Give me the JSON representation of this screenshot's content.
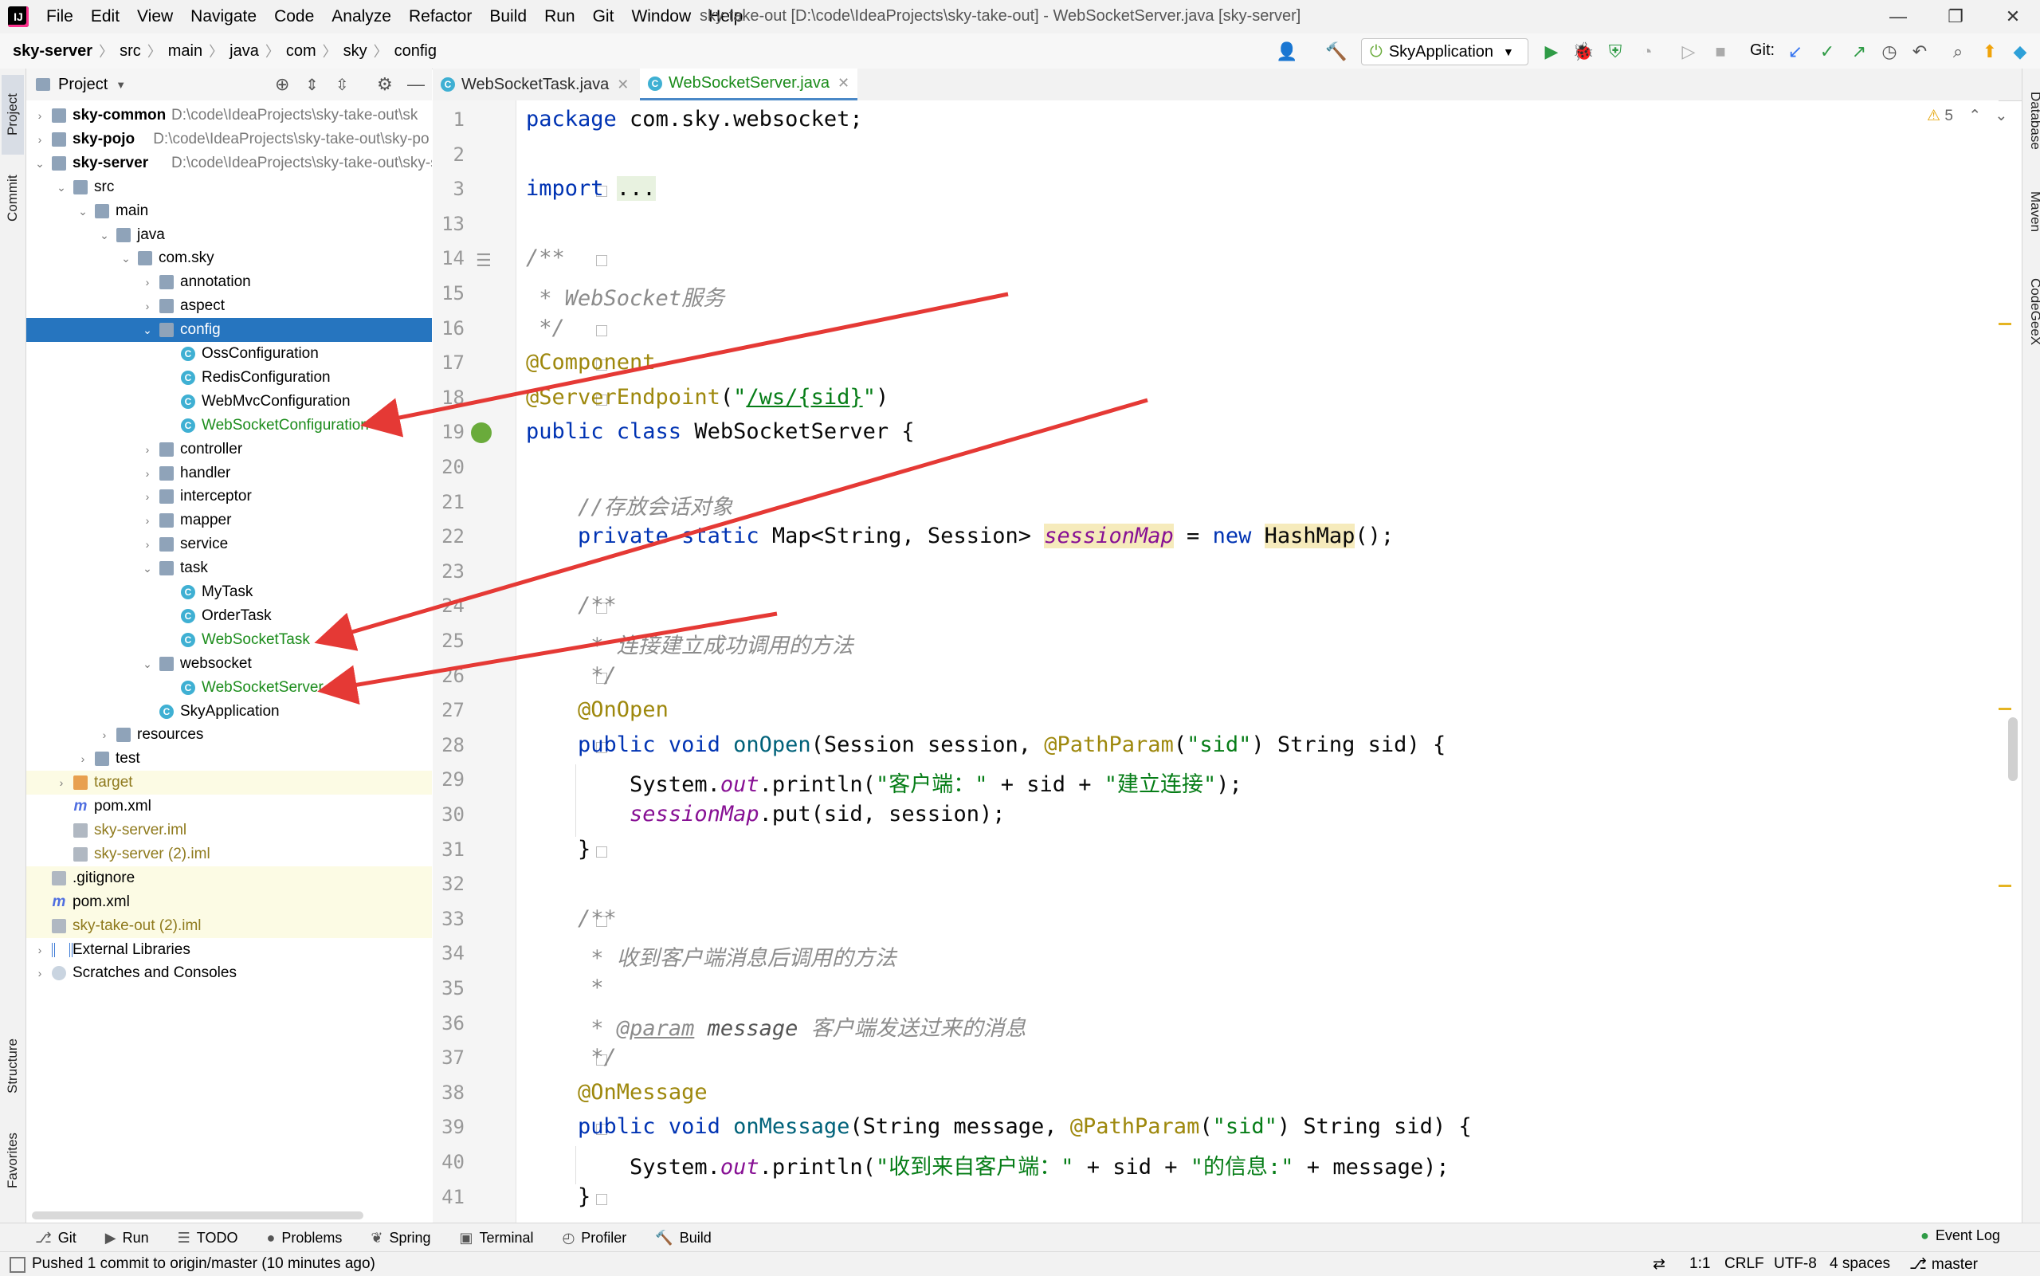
{
  "menu": [
    "File",
    "Edit",
    "View",
    "Navigate",
    "Code",
    "Analyze",
    "Refactor",
    "Build",
    "Run",
    "Git",
    "Window",
    "Help"
  ],
  "window_title": "sky-take-out [D:\\code\\IdeaProjects\\sky-take-out] - WebSocketServer.java [sky-server]",
  "breadcrumb": [
    "sky-server",
    "src",
    "main",
    "java",
    "com",
    "sky",
    "config"
  ],
  "run_config": "SkyApplication",
  "git_label": "Git:",
  "project_panel": {
    "title": "Project"
  },
  "tree": [
    {
      "depth": 0,
      "arrow": "›",
      "icon": "module",
      "label": "sky-common",
      "bold": true,
      "path": "D:\\code\\IdeaProjects\\sky-take-out\\sk"
    },
    {
      "depth": 0,
      "arrow": "›",
      "icon": "module",
      "label": "sky-pojo",
      "bold": true,
      "path": "D:\\code\\IdeaProjects\\sky-take-out\\sky-po"
    },
    {
      "depth": 0,
      "arrow": "⌄",
      "icon": "module",
      "label": "sky-server",
      "bold": true,
      "path": "D:\\code\\IdeaProjects\\sky-take-out\\sky-s"
    },
    {
      "depth": 1,
      "arrow": "⌄",
      "icon": "folder",
      "label": "src"
    },
    {
      "depth": 2,
      "arrow": "⌄",
      "icon": "folder",
      "label": "main"
    },
    {
      "depth": 3,
      "arrow": "⌄",
      "icon": "folder",
      "label": "java"
    },
    {
      "depth": 4,
      "arrow": "⌄",
      "icon": "folder",
      "label": "com.sky"
    },
    {
      "depth": 5,
      "arrow": "›",
      "icon": "folder",
      "label": "annotation"
    },
    {
      "depth": 5,
      "arrow": "›",
      "icon": "folder",
      "label": "aspect"
    },
    {
      "depth": 5,
      "arrow": "⌄",
      "icon": "folder",
      "label": "config",
      "selected": true
    },
    {
      "depth": 6,
      "arrow": "",
      "icon": "class",
      "label": "OssConfiguration"
    },
    {
      "depth": 6,
      "arrow": "",
      "icon": "class",
      "label": "RedisConfiguration"
    },
    {
      "depth": 6,
      "arrow": "",
      "icon": "class",
      "label": "WebMvcConfiguration"
    },
    {
      "depth": 6,
      "arrow": "",
      "icon": "class",
      "label": "WebSocketConfiguration",
      "color": "green"
    },
    {
      "depth": 5,
      "arrow": "›",
      "icon": "folder",
      "label": "controller"
    },
    {
      "depth": 5,
      "arrow": "›",
      "icon": "folder",
      "label": "handler"
    },
    {
      "depth": 5,
      "arrow": "›",
      "icon": "folder",
      "label": "interceptor"
    },
    {
      "depth": 5,
      "arrow": "›",
      "icon": "folder",
      "label": "mapper"
    },
    {
      "depth": 5,
      "arrow": "›",
      "icon": "folder",
      "label": "service"
    },
    {
      "depth": 5,
      "arrow": "⌄",
      "icon": "folder",
      "label": "task"
    },
    {
      "depth": 6,
      "arrow": "",
      "icon": "class",
      "label": "MyTask"
    },
    {
      "depth": 6,
      "arrow": "",
      "icon": "class",
      "label": "OrderTask"
    },
    {
      "depth": 6,
      "arrow": "",
      "icon": "class",
      "label": "WebSocketTask",
      "color": "green"
    },
    {
      "depth": 5,
      "arrow": "⌄",
      "icon": "folder",
      "label": "websocket"
    },
    {
      "depth": 6,
      "arrow": "",
      "icon": "class",
      "label": "WebSocketServer",
      "color": "green"
    },
    {
      "depth": 5,
      "arrow": "",
      "icon": "class",
      "label": "SkyApplication"
    },
    {
      "depth": 3,
      "arrow": "›",
      "icon": "folder",
      "label": "resources"
    },
    {
      "depth": 2,
      "arrow": "›",
      "icon": "folder",
      "label": "test"
    },
    {
      "depth": 1,
      "arrow": "›",
      "icon": "folder-orange",
      "label": "target",
      "yellow": true,
      "color": "olive"
    },
    {
      "depth": 1,
      "arrow": "",
      "icon": "maven",
      "label": "pom.xml"
    },
    {
      "depth": 1,
      "arrow": "",
      "icon": "iml",
      "label": "sky-server.iml",
      "color": "olive"
    },
    {
      "depth": 1,
      "arrow": "",
      "icon": "iml",
      "label": "sky-server (2).iml",
      "color": "olive"
    },
    {
      "depth": 0,
      "arrow": "",
      "icon": "iml",
      "label": ".gitignore",
      "yellow": true
    },
    {
      "depth": 0,
      "arrow": "",
      "icon": "maven",
      "label": "pom.xml",
      "yellow": true
    },
    {
      "depth": 0,
      "arrow": "",
      "icon": "iml",
      "label": "sky-take-out (2).iml",
      "yellow": true,
      "color": "olive"
    },
    {
      "depth": 0,
      "arrow": "›",
      "icon": "lib",
      "label": "External Libraries"
    },
    {
      "depth": 0,
      "arrow": "›",
      "icon": "scratch",
      "label": "Scratches and Consoles"
    }
  ],
  "tabs": [
    {
      "label": "WebSocketTask.java",
      "active": false
    },
    {
      "label": "WebSocketServer.java",
      "active": true
    }
  ],
  "warnings": "5",
  "code_lines": [
    {
      "n": "1",
      "html": "<span class='kw'>package</span> com.sky.websocket;"
    },
    {
      "n": "2",
      "html": ""
    },
    {
      "n": "3",
      "html": "<span class='kw'>import</span> <span style='background:#e8f2e0'>...</span>"
    },
    {
      "n": "13",
      "html": ""
    },
    {
      "n": "14",
      "html": "<span class='cmt'>/**</span>"
    },
    {
      "n": "15",
      "html": "<span class='cmt'> * WebSocket服务</span>"
    },
    {
      "n": "16",
      "html": "<span class='cmt'> */</span>"
    },
    {
      "n": "17",
      "html": "<span class='ann'>@Component</span>"
    },
    {
      "n": "18",
      "html": "<span class='ann'>@ServerEndpoint</span>(<span class='str'>\"</span><span class='strU'>/ws/{sid}</span><span class='str'>\"</span>)"
    },
    {
      "n": "19",
      "html": "<span class='kw'>public class</span> WebSocketServer {"
    },
    {
      "n": "20",
      "html": ""
    },
    {
      "n": "21",
      "html": "    <span class='cmt'>//存放会话对象</span>"
    },
    {
      "n": "22",
      "html": "    <span class='kw'>private static</span> Map&lt;String, Session&gt; <span class='fld hl'>sessionMap</span> = <span class='kw'>new</span> <span class='hl'>HashMap</span>();"
    },
    {
      "n": "23",
      "html": ""
    },
    {
      "n": "24",
      "html": "    <span class='cmt'>/**</span>"
    },
    {
      "n": "25",
      "html": "    <span class='cmt'> * 连接建立成功调用的方法</span>"
    },
    {
      "n": "26",
      "html": "    <span class='cmt'> */</span>"
    },
    {
      "n": "27",
      "html": "    <span class='ann'>@OnOpen</span>"
    },
    {
      "n": "28",
      "html": "    <span class='kw'>public void</span> <span class='mth'>onOpen</span>(Session session, <span class='ann'>@PathParam</span>(<span class='str'>\"sid\"</span>) String sid) {"
    },
    {
      "n": "29",
      "html": "        System.<span class='fld'>out</span>.println(<span class='str'>\"客户端：\"</span> + sid + <span class='str'>\"建立连接\"</span>);"
    },
    {
      "n": "30",
      "html": "        <span class='fld'>sessionMap</span>.put(sid, session);"
    },
    {
      "n": "31",
      "html": "    }"
    },
    {
      "n": "32",
      "html": ""
    },
    {
      "n": "33",
      "html": "    <span class='cmt'>/**</span>"
    },
    {
      "n": "34",
      "html": "    <span class='cmt'> * 收到客户端消息后调用的方法</span>"
    },
    {
      "n": "35",
      "html": "    <span class='cmt'> *</span>"
    },
    {
      "n": "36",
      "html": "    <span class='cmt'> * <u>@param</u> <b style='font-weight:normal;color:#555'>message</b> 客户端发送过来的消息</span>"
    },
    {
      "n": "37",
      "html": "    <span class='cmt'> */</span>"
    },
    {
      "n": "38",
      "html": "    <span class='ann'>@OnMessage</span>"
    },
    {
      "n": "39",
      "html": "    <span class='kw'>public void</span> <span class='mth'>onMessage</span>(String message, <span class='ann'>@PathParam</span>(<span class='str'>\"sid\"</span>) String sid) {"
    },
    {
      "n": "40",
      "html": "        System.<span class='fld'>out</span>.println(<span class='str'>\"收到来自客户端：\"</span> + sid + <span class='str'>\"的信息:\"</span> + message);"
    },
    {
      "n": "41",
      "html": "    }"
    }
  ],
  "left_tabs": [
    "Project",
    "Commit",
    "Structure",
    "Favorites"
  ],
  "right_tabs": [
    "Database",
    "Maven",
    "CodeGeeX"
  ],
  "toolwindows": [
    "Git",
    "Run",
    "TODO",
    "Problems",
    "Spring",
    "Terminal",
    "Profiler",
    "Build"
  ],
  "event_log": "Event Log",
  "status": {
    "message": "Pushed 1 commit to origin/master (10 minutes ago)",
    "position": "1:1",
    "line_sep": "CRLF",
    "encoding": "UTF-8",
    "indent": "4 spaces",
    "branch": "master"
  }
}
